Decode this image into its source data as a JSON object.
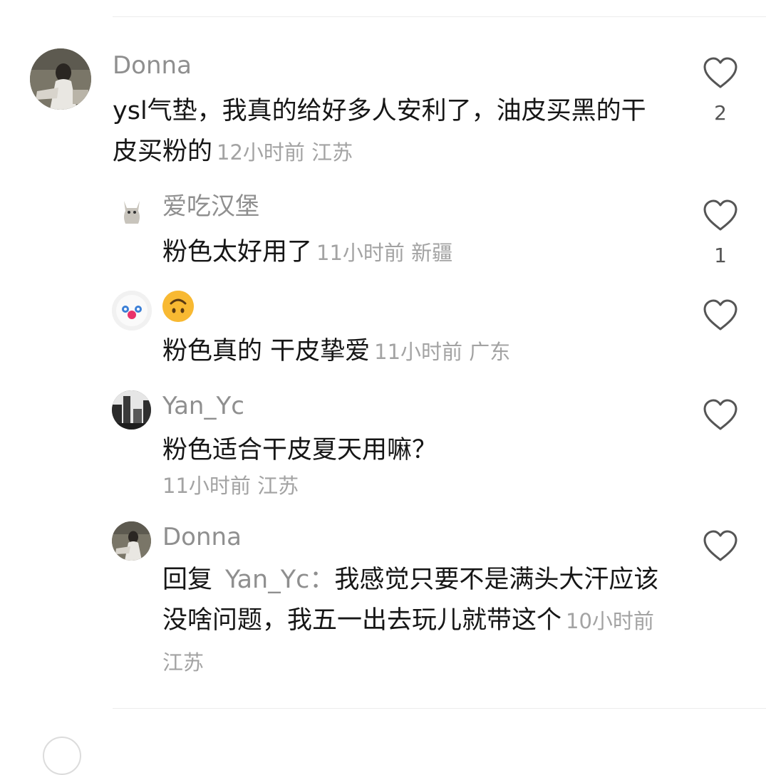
{
  "comments": [
    {
      "name": "Donna",
      "text": "ysl气垫，我真的给好多人安利了，油皮买黑的干皮买粉的",
      "meta": "12小时前  江苏",
      "likes": "2"
    },
    {
      "name": "爱吃汉堡",
      "text": "粉色太好用了",
      "meta": "11小时前  新疆",
      "likes": "1"
    },
    {
      "name": "",
      "name_icon": "upside-down-face-emoji",
      "text": "粉色真的 干皮挚爱",
      "meta": "11小时前  广东",
      "likes": ""
    },
    {
      "name": "Yan_Yc",
      "text": "粉色适合干皮夏天用嘛？",
      "meta": "11小时前  江苏",
      "likes": ""
    },
    {
      "name": "Donna",
      "reply_prefix": "回复",
      "reply_target": "Yan_Yc：",
      "text": "我感觉只要不是满头大汗应该没啥问题，我五一出去玩儿就带这个",
      "meta": "10小时前  江苏",
      "likes": ""
    }
  ],
  "icons": {
    "like": "heart-outline-icon"
  },
  "colors": {
    "name": "#8f8f8f",
    "text": "#161616",
    "meta": "#a3a3a3",
    "icon": "#555555"
  }
}
